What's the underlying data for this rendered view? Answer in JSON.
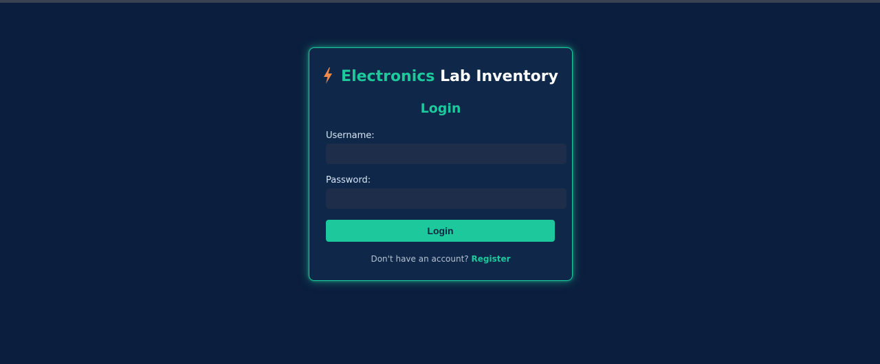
{
  "app": {
    "title_brand": "Electronics",
    "title_rest": " Lab Inventory",
    "logo_icon": "lightning-bolt-icon"
  },
  "form": {
    "heading": "Login",
    "username_label": "Username:",
    "username_value": "",
    "password_label": "Password:",
    "password_value": "",
    "submit_label": "Login"
  },
  "footer": {
    "prompt": "Don't have an account?",
    "register_label": "Register"
  },
  "colors": {
    "background": "#0b1e3d",
    "card": "#0f2748",
    "accent": "#1dc99c",
    "bolt": "#f08a4b"
  }
}
